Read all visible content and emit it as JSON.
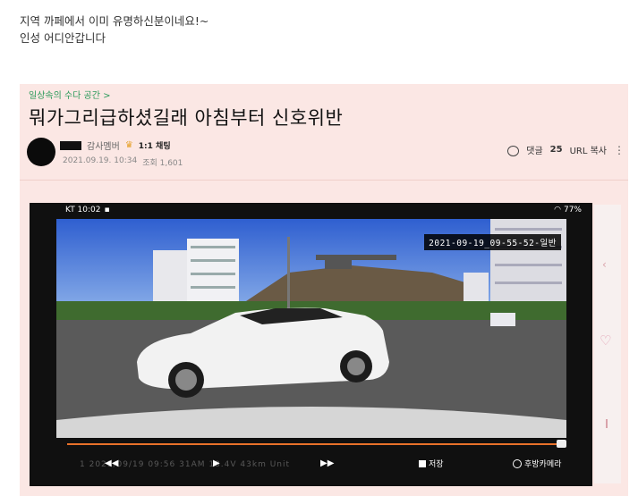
{
  "caption": {
    "line1": "지역 까페에서 이미 유명하신분이네요!~",
    "line2": "인성 어디안갑니다"
  },
  "post": {
    "breadcrumb": "일상속의 수다 공간 >",
    "title": "뭐가그리급하셨길래 아침부터 신호위반",
    "author_grade": "감사멤버",
    "chat_label": "1:1 채팅",
    "date": "2021.09.19. 10:34",
    "views": "조회 1,601",
    "comment_label": "댓글",
    "comment_count": "25",
    "url_copy": "URL 복사",
    "more": "⋮"
  },
  "video": {
    "status_left": "KT 10:02",
    "status_right": "77%",
    "timestamp": "2021-09-19_09-55-52-일반",
    "progress": 0.985,
    "info_text": "1 2021/09/19 09:56 31AM 13.4V 43km Unit",
    "prev": "◀◀",
    "play": "▶",
    "next": "▶▶",
    "save_label": "저장",
    "rear_label": "후방카메라"
  },
  "colors": {
    "post_bg": "#fbe7e4",
    "breadcrumb": "#2b9a5a",
    "progress": "#e8712a"
  }
}
